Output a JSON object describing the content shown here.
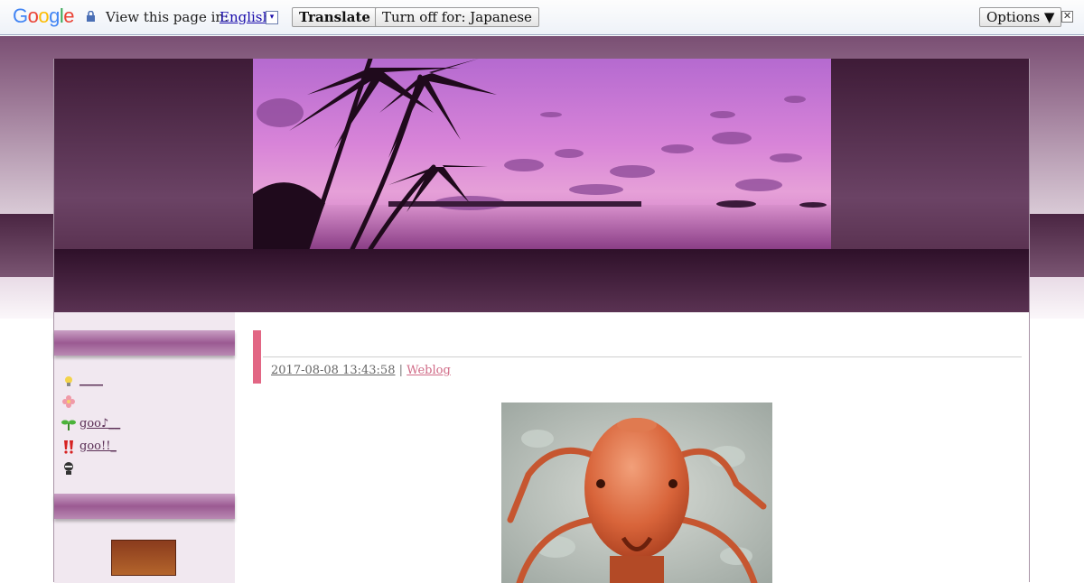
{
  "translate_bar": {
    "logo": "Google",
    "view_label": "View this page in:",
    "language": "English",
    "dropdown_glyph": "▾",
    "translate_button": "Translate",
    "turn_off_button": "Turn off for: Japanese",
    "options_button": "Options ▼",
    "close_glyph": "✕"
  },
  "sidebar": {
    "items": [
      {
        "icon": "lightbulb-icon",
        "label": "____"
      },
      {
        "icon": "flower-icon",
        "label": ""
      },
      {
        "icon": "sprout-icon",
        "label": "goo♪__"
      },
      {
        "icon": "exclamation-icon",
        "label": "goo!!_"
      },
      {
        "icon": "ninja-icon",
        "label": ""
      }
    ]
  },
  "entry": {
    "date": "2017-08-08 13:43:58",
    "separator": "|",
    "category": "Weblog"
  },
  "colors": {
    "accent": "#e26684",
    "sidebar_bg": "#f1e8f0",
    "header_purple": "#6b4365"
  }
}
